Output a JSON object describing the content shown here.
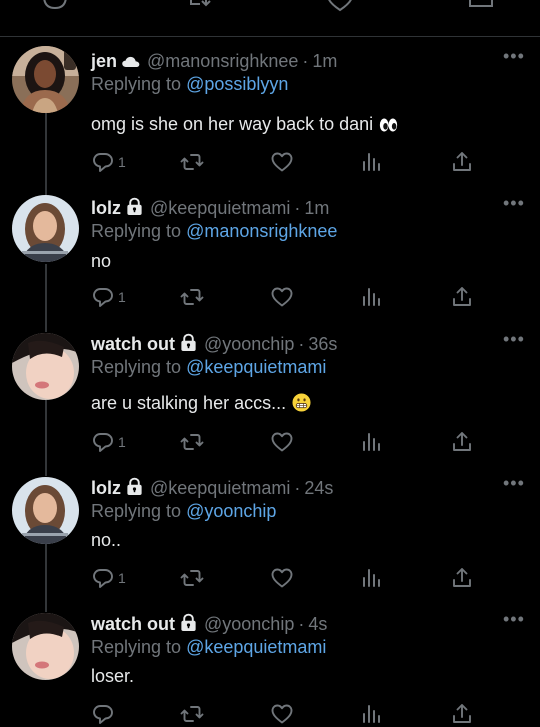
{
  "tweets": [
    {
      "name": "jen",
      "badge": "cloud",
      "handle": "@manonsrighknee",
      "time": "1m",
      "replying_prefix": "Replying to",
      "replying_to": "@possiblyyn",
      "text": "omg is she on her way back to dani",
      "emoji": "eyes",
      "reply_count": "1",
      "retweet_count": "",
      "like_count": ""
    },
    {
      "name": "lolz",
      "badge": "lock",
      "handle": "@keepquietmami",
      "time": "1m",
      "replying_prefix": "Replying to",
      "replying_to": "@manonsrighknee",
      "text": "no",
      "emoji": "",
      "reply_count": "1",
      "retweet_count": "",
      "like_count": ""
    },
    {
      "name": "watch out",
      "badge": "lock",
      "handle": "@yoonchip",
      "time": "36s",
      "replying_prefix": "Replying to",
      "replying_to": "@keepquietmami",
      "text": "are u stalking her accs...",
      "emoji": "grimacing-face",
      "reply_count": "1",
      "retweet_count": "",
      "like_count": ""
    },
    {
      "name": "lolz",
      "badge": "lock",
      "handle": "@keepquietmami",
      "time": "24s",
      "replying_prefix": "Replying to",
      "replying_to": "@yoonchip",
      "text": "no..",
      "emoji": "",
      "reply_count": "1",
      "retweet_count": "",
      "like_count": ""
    },
    {
      "name": "watch out",
      "badge": "lock",
      "handle": "@yoonchip",
      "time": "4s",
      "replying_prefix": "Replying to",
      "replying_to": "@keepquietmami",
      "text": "loser.",
      "emoji": "",
      "reply_count": "",
      "retweet_count": "",
      "like_count": ""
    }
  ],
  "more_label": "•••",
  "handle_separator": "·",
  "colors": {
    "background": "#000000",
    "text": "#e7e9ea",
    "secondary": "#71767b",
    "link": "#5ea6e6",
    "divider": "#2f3336"
  },
  "icons": [
    "reply-icon",
    "retweet-icon",
    "like-icon",
    "views-icon",
    "share-icon",
    "lock-icon",
    "cloud-icon",
    "more-icon"
  ]
}
